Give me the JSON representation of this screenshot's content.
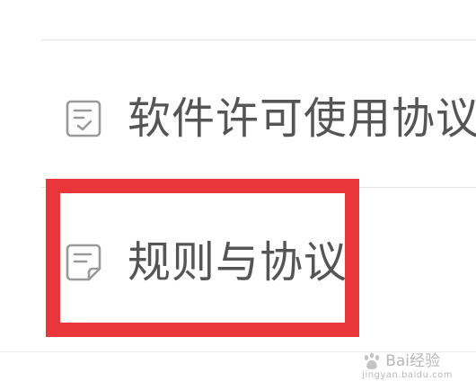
{
  "menu": {
    "items": [
      {
        "label": "软件许可使用协议",
        "icon": "document-check-icon"
      },
      {
        "label": "规则与协议",
        "icon": "document-lines-icon"
      }
    ]
  },
  "colors": {
    "text": "#555555",
    "icon": "#9a9a9a",
    "highlight": "#e8363b",
    "divider": "#e6e6e6"
  },
  "watermark": {
    "brand": "Bai经验",
    "url": "jingyan.baidu.com"
  }
}
